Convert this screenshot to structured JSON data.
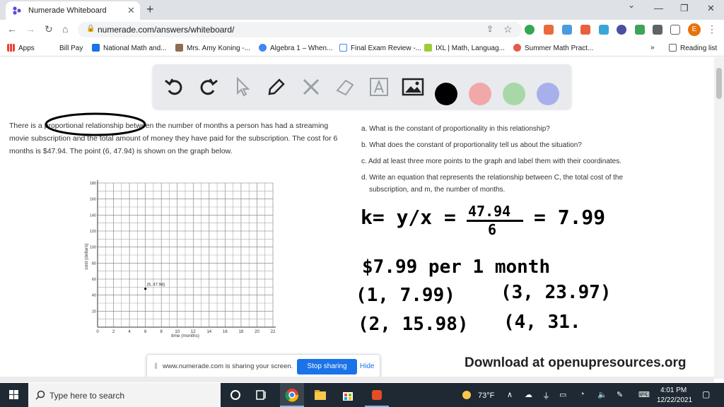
{
  "browser": {
    "tab_title": "Numerade Whiteboard",
    "tab_close": "✕",
    "new_tab": "+",
    "url": "numerade.com/answers/whiteboard/",
    "avatar_letter": "E",
    "window_controls": {
      "minimize": "—",
      "maximize": "❐",
      "close": "✕"
    }
  },
  "bookmarks": {
    "items": [
      {
        "label": "Apps",
        "color": "#ea4335"
      },
      {
        "label": "Bill Pay",
        "color": ""
      },
      {
        "label": "National Math and...",
        "color": "#1a73e8"
      },
      {
        "label": "Mrs. Amy Koning -...",
        "color": "#8e6e4e"
      },
      {
        "label": "Algebra 1 – When...",
        "color": "#4285f4"
      },
      {
        "label": "Final Exam Review -...",
        "color": "#4285f4"
      },
      {
        "label": "IXL | Math, Languag...",
        "color": "#9fcb3b"
      },
      {
        "label": "Summer Math Pract...",
        "color": "#e35b4b"
      }
    ],
    "more": "»",
    "reading_list": "Reading list"
  },
  "whiteboard": {
    "tools": [
      "undo-icon",
      "redo-icon",
      "pointer-icon",
      "pen-icon",
      "tools-icon",
      "eraser-icon",
      "text-icon",
      "image-icon"
    ],
    "swatches": [
      "#000000",
      "#f0a8a8",
      "#a8d8a8",
      "#a8b0ec"
    ]
  },
  "problem": {
    "text": "There is a proportional relationship between the number of months a person has had a streaming movie subscription and the total amount of money they have paid for the subscription. The cost for 6 months is $47.94. The point (6, 47.94) is shown on the graph below.",
    "questions": {
      "a": "a. What is the constant of proportionality in this relationship?",
      "b": "b. What does the constant of proportionality tell us about the situation?",
      "c": "c. Add at least three more points to the graph and label them with their coordinates.",
      "d1": "d. Write an equation that represents the relationship between C, the total cost of the",
      "d2": "subscription, and m, the number of months."
    }
  },
  "graph": {
    "xlabel": "time (months)",
    "ylabel": "cost (dollars)",
    "x_ticks": [
      "0",
      "2",
      "4",
      "6",
      "8",
      "10",
      "12",
      "14",
      "16",
      "18",
      "20",
      "22"
    ],
    "y_ticks": [
      "20",
      "40",
      "60",
      "80",
      "100",
      "120",
      "140",
      "160",
      "180"
    ],
    "point_label": "(6, 47.94)",
    "point": {
      "x": 6,
      "y": 47.94
    },
    "xlim": [
      0,
      22
    ],
    "ylim": [
      0,
      180
    ]
  },
  "handwriting": {
    "line1_left": "k= y/x =",
    "frac_num": "47.94",
    "frac_den": "6",
    "line1_right": "= 7.99",
    "line2": "$7.99 per 1 month",
    "pt1": "(1, 7.99)",
    "pt2": "(3, 23.97)",
    "pt3": "(2, 15.98)",
    "pt4": "(4, 31."
  },
  "footer": {
    "download": "Download at openupresources.org"
  },
  "share_bar": {
    "message": "www.numerade.com is sharing your screen.",
    "stop": "Stop sharing",
    "hide": "Hide"
  },
  "taskbar": {
    "search_placeholder": "Type here to search",
    "weather": "73°F",
    "time": "4:01 PM",
    "date": "12/22/2021"
  }
}
